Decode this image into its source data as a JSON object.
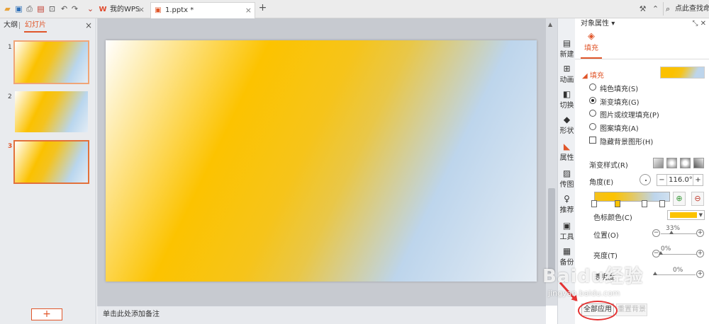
{
  "titlebar": {
    "quick_access": [
      "open-icon",
      "save-icon",
      "print-preview-icon",
      "export-pdf-icon",
      "print-icon",
      "undo-icon",
      "redo-icon",
      "customize-icon"
    ],
    "tabs": [
      {
        "icon": "wps-logo-icon",
        "label": "我的WPS"
      },
      {
        "icon": "pptx-file-icon",
        "label": "1.pptx *"
      }
    ],
    "new_tab": "+",
    "search_placeholder": "点此查找命令"
  },
  "left_panel": {
    "tab_outline": "大纲",
    "tab_slides": "幻灯片",
    "close": "×",
    "slides": [
      {
        "number": "1"
      },
      {
        "number": "2"
      },
      {
        "number": "3"
      }
    ],
    "add_button": "+"
  },
  "notes": {
    "placeholder": "单击此处添加备注"
  },
  "icon_bar": {
    "items": [
      {
        "icon": "new-icon",
        "label": "新建"
      },
      {
        "icon": "animation-icon",
        "label": "动画"
      },
      {
        "icon": "transition-icon",
        "label": "切换"
      },
      {
        "icon": "shape-icon",
        "label": "形状"
      },
      {
        "icon": "property-icon",
        "label": "属性"
      },
      {
        "icon": "image-icon",
        "label": "传图"
      },
      {
        "icon": "recommend-icon",
        "label": "推荐"
      },
      {
        "icon": "tools-icon",
        "label": "工具"
      },
      {
        "icon": "backup-icon",
        "label": "备份"
      }
    ]
  },
  "property_panel": {
    "title": "对象属性",
    "title_caret": "▾",
    "fill_tab": "填充",
    "section": "填充",
    "options": [
      {
        "label": "纯色填充(S)",
        "checked": false
      },
      {
        "label": "渐变填充(G)",
        "checked": true
      },
      {
        "label": "图片或纹理填充(P)",
        "checked": false
      },
      {
        "label": "图案填充(A)",
        "checked": false
      }
    ],
    "hide_bg_label": "隐藏背景图形(H)",
    "gradient_style_label": "渐变样式(R)",
    "angle_label": "角度(E)",
    "angle_value": "116.0°",
    "minus": "−",
    "plus": "+",
    "color_stop_label": "色标颜色(C)",
    "stop_color": "#fcc300",
    "position_label": "位置(O)",
    "position_value": "33%",
    "brightness_label": "亮度(T)",
    "brightness_value": "0%",
    "transparency_label": "透明度",
    "transparency_value": "0%",
    "apply_all": "全部应用",
    "reset_bg": "重置背景"
  },
  "watermark": {
    "text": "Baidu经验",
    "url": "jingyan.baidu.com"
  },
  "colors": {
    "accent": "#e0562a",
    "gradient_gold": "#fcc300",
    "gradient_blue": "#bdd5ec",
    "highlight_red": "#e53333"
  }
}
